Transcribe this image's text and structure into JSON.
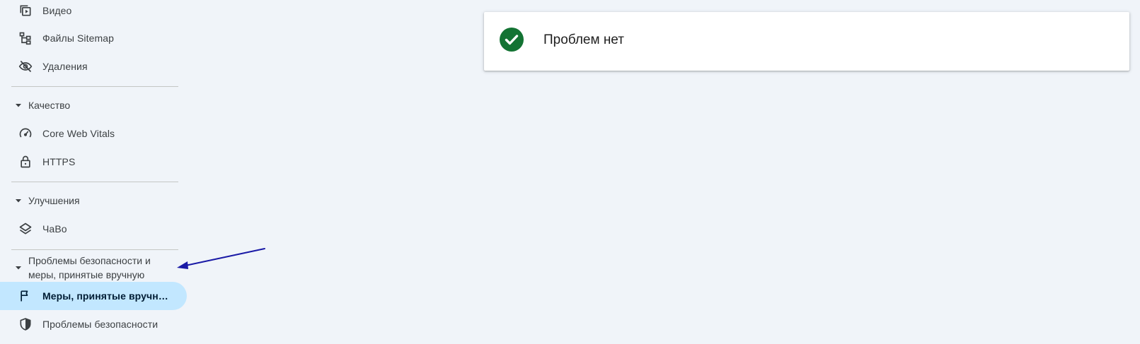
{
  "sidebar": {
    "items": {
      "video": {
        "label": "Видео",
        "icon": "video-icon"
      },
      "sitemaps": {
        "label": "Файлы Sitemap",
        "icon": "sitemap-icon"
      },
      "removals": {
        "label": "Удаления",
        "icon": "eye-off-icon"
      },
      "core_web_vitals": {
        "label": "Core Web Vitals",
        "icon": "speedometer-icon"
      },
      "https": {
        "label": "HTTPS",
        "icon": "lock-icon"
      },
      "faq": {
        "label": "ЧаВо",
        "icon": "layers-icon"
      },
      "manual_actions": {
        "label": "Меры, принятые вручн…",
        "icon": "flag-icon"
      },
      "security_issues": {
        "label": "Проблемы безопасности",
        "icon": "shield-icon"
      }
    },
    "sections": {
      "quality": {
        "label": "Качество"
      },
      "enhancements": {
        "label": "Улучшения"
      },
      "security": {
        "label_line1": "Проблемы безопасности и",
        "label_line2": "меры, принятые вручную"
      }
    },
    "active_item": "manual_actions"
  },
  "status_card": {
    "text": "Проблем нет",
    "icon": "check-circle-icon"
  },
  "colors": {
    "background": "#f0f4f9",
    "active_item_bg": "#c2e7ff",
    "success_green": "#137333",
    "annotation_arrow": "#1a1aa6"
  }
}
